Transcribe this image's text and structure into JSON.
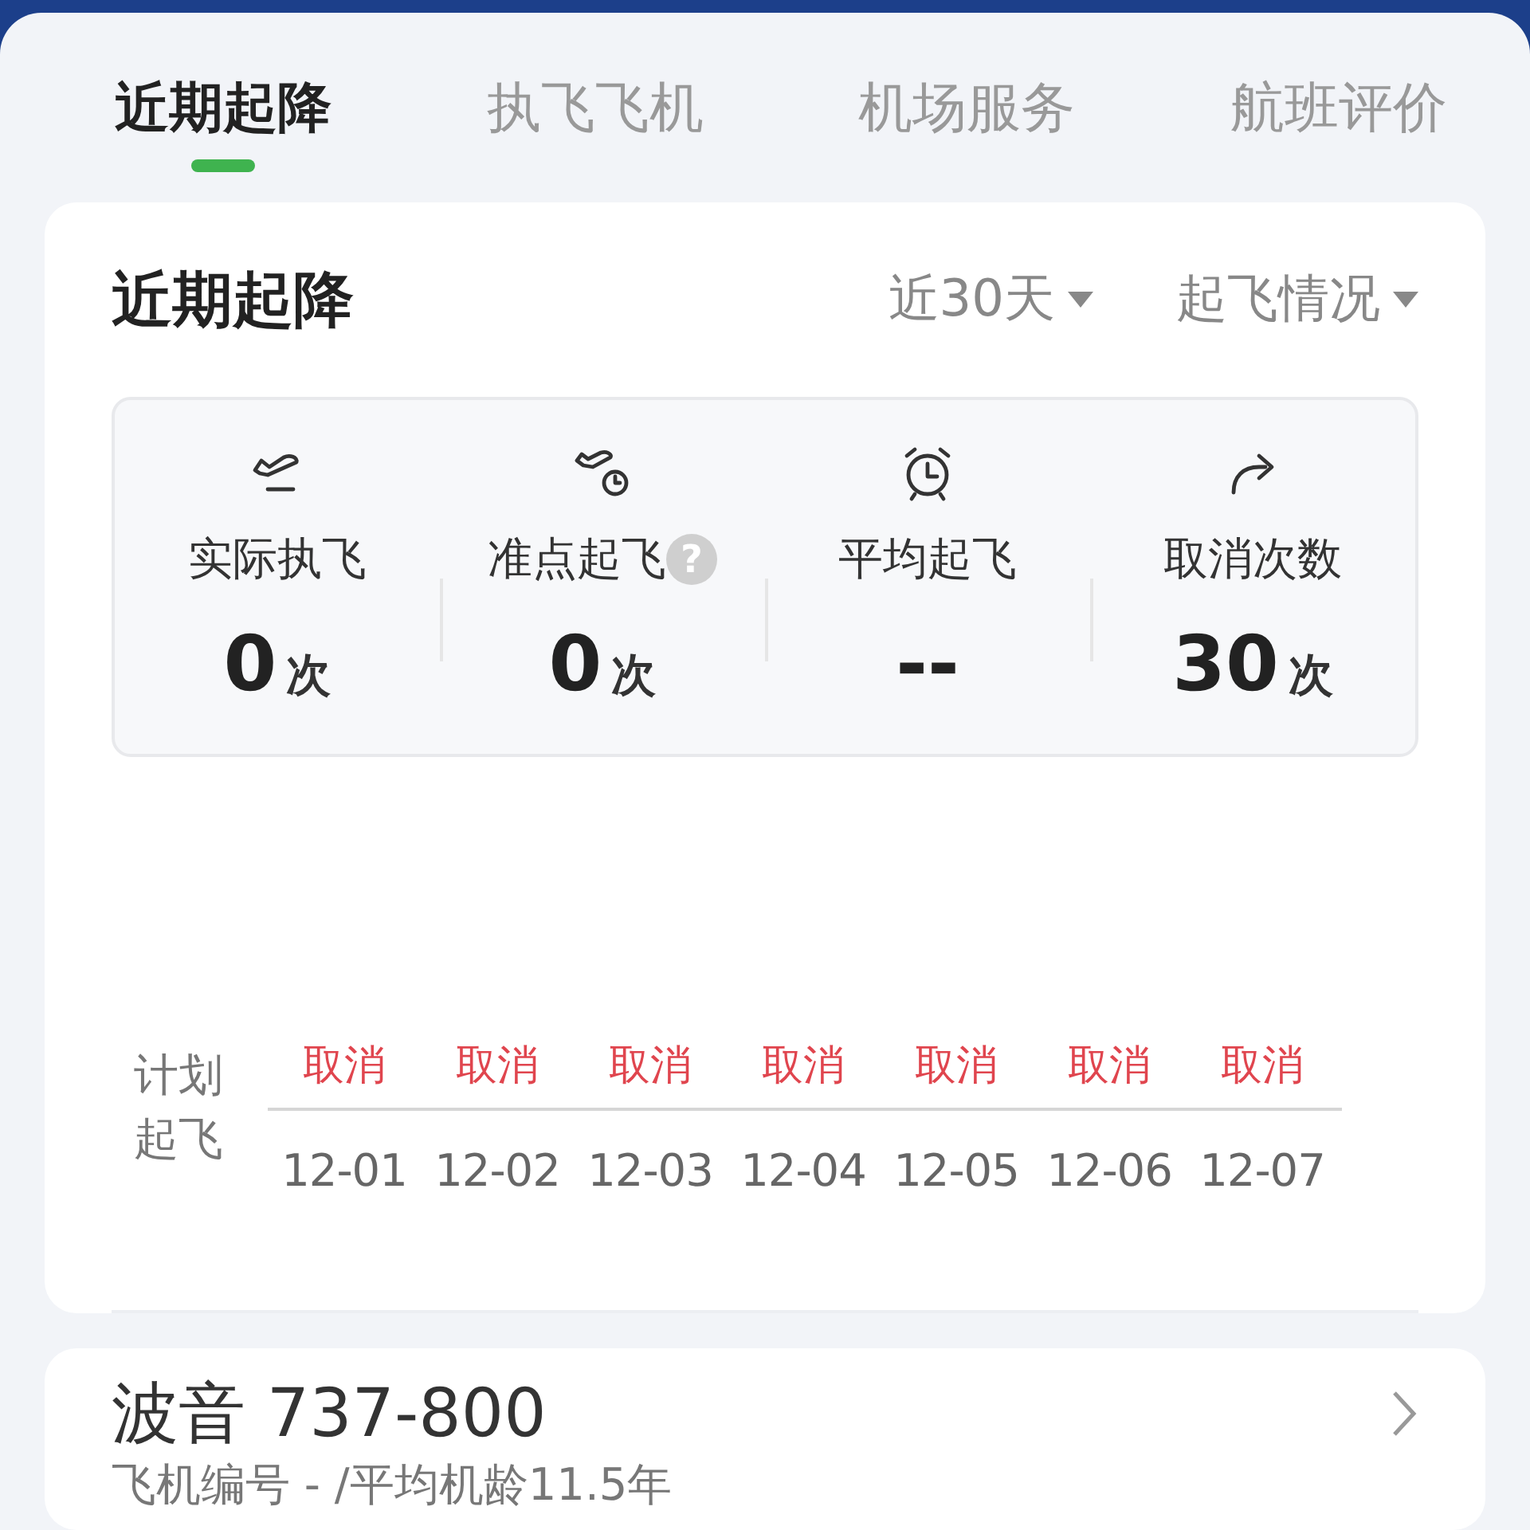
{
  "tabs": [
    {
      "label": "近期起降",
      "selected": true
    },
    {
      "label": "执飞飞机",
      "selected": false
    },
    {
      "label": "机场服务",
      "selected": false
    },
    {
      "label": "航班评价",
      "selected": false
    }
  ],
  "recent": {
    "title": "近期起降",
    "filters": [
      "近30天",
      "起飞情况"
    ],
    "stats": [
      {
        "label": "实际执飞",
        "value": "0",
        "unit": "次"
      },
      {
        "label": "准点起飞",
        "value": "0",
        "unit": "次",
        "help": "?"
      },
      {
        "label": "平均起飞",
        "value": "--"
      },
      {
        "label": "取消次数",
        "value": "30",
        "unit": "次"
      }
    ],
    "schedule": {
      "label": "计划起飞",
      "days": [
        {
          "status": "取消",
          "date": "12-01"
        },
        {
          "status": "取消",
          "date": "12-02"
        },
        {
          "status": "取消",
          "date": "12-03"
        },
        {
          "status": "取消",
          "date": "12-04"
        },
        {
          "status": "取消",
          "date": "12-05"
        },
        {
          "status": "取消",
          "date": "12-06"
        },
        {
          "status": "取消",
          "date": "12-07"
        }
      ]
    }
  },
  "aircraft": {
    "model": "波音 737-800",
    "detail": "飞机编号 - /平均机龄11.5年"
  }
}
